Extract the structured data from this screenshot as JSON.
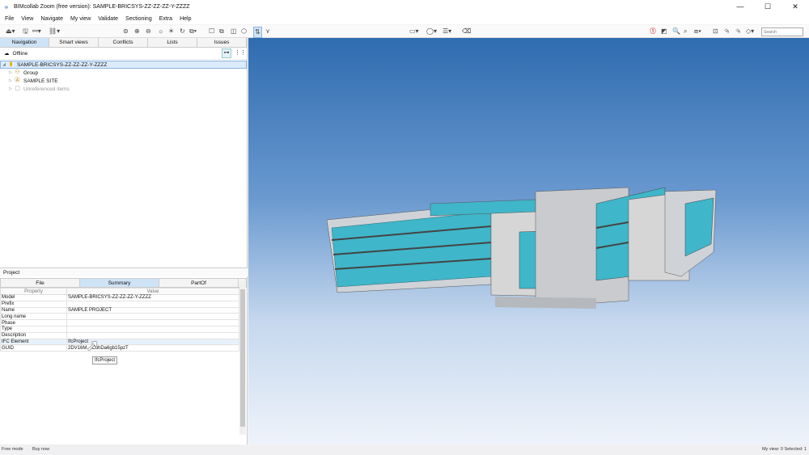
{
  "window": {
    "title": "BIMcollab Zoom (free version): SAMPLE-BRICSYS-ZZ-ZZ-ZZ-Y-ZZZZ",
    "minimize": "—",
    "maximize": "☐",
    "close": "✕"
  },
  "menu": [
    "File",
    "View",
    "Navigate",
    "My view",
    "Validate",
    "Sectioning",
    "Extra",
    "Help"
  ],
  "toolbar": {
    "search_placeholder": "Search"
  },
  "nav_tabs": [
    "Navigation",
    "Smart views",
    "Conflicts",
    "Lists",
    "Issues"
  ],
  "status_label": "Offline",
  "tree": [
    {
      "label": "SAMPLE-BRICSYS-ZZ-ZZ-ZZ-Y-ZZZZ",
      "icon": "file-icon",
      "selected": true
    },
    {
      "label": "Group",
      "icon": "group-icon"
    },
    {
      "label": "SAMPLE SITE",
      "icon": "site-icon"
    },
    {
      "label": "Unreferenced items",
      "icon": "box-icon",
      "dim": true
    }
  ],
  "properties": {
    "panel_title": "Project",
    "tabs": [
      "File",
      "Summary",
      "PartOf"
    ],
    "more": "›",
    "headers": [
      "Property",
      "Value"
    ],
    "rows": [
      [
        "Model",
        "SAMPLE-BRICSYS-ZZ-ZZ-ZZ-Y-ZZZZ"
      ],
      [
        "Prefix",
        ""
      ],
      [
        "Name",
        "SAMPLE PROJECT"
      ],
      [
        "Long name",
        ""
      ],
      [
        "Phase",
        ""
      ],
      [
        "Type",
        ""
      ],
      [
        "Description",
        ""
      ],
      [
        "IFC Element",
        "IfcProject"
      ],
      [
        "GUID",
        "2DV16M…CuhDa6gb15pzT"
      ]
    ],
    "tooltip": "IfcProject"
  },
  "statusbar": {
    "mode": "Free mode",
    "buy": "Buy now",
    "right": "My view: 0  Selected: 1"
  },
  "colors": {
    "accent": "#cfe3f7",
    "sky_top": "#2f6cb0",
    "glass": "#3fb6c9"
  }
}
